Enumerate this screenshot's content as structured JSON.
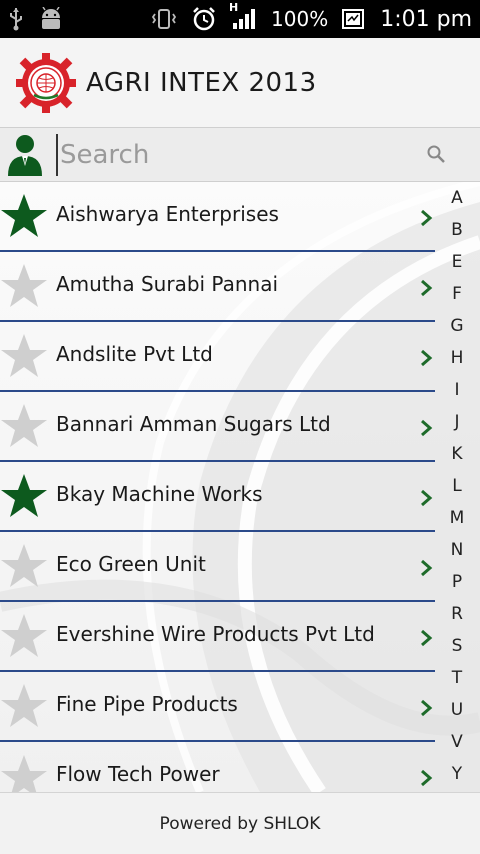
{
  "status_bar": {
    "battery": "100%",
    "time": "1:01 pm",
    "network_label": "H"
  },
  "header": {
    "title": "AGRI INTEX 2013"
  },
  "search": {
    "placeholder": "Search",
    "value": ""
  },
  "list": {
    "items": [
      {
        "label": "Aishwarya Enterprises",
        "favorite": true
      },
      {
        "label": "Amutha Surabi Pannai",
        "favorite": false
      },
      {
        "label": "Andslite Pvt Ltd",
        "favorite": false
      },
      {
        "label": "Bannari Amman Sugars Ltd",
        "favorite": false
      },
      {
        "label": "Bkay Machine Works",
        "favorite": true
      },
      {
        "label": "Eco Green Unit",
        "favorite": false
      },
      {
        "label": "Evershine Wire Products Pvt Ltd",
        "favorite": false
      },
      {
        "label": "Fine Pipe Products",
        "favorite": false
      },
      {
        "label": "Flow Tech Power",
        "favorite": false
      }
    ]
  },
  "alphabet_index": [
    "A",
    "B",
    "E",
    "F",
    "G",
    "H",
    "I",
    "J",
    "K",
    "L",
    "M",
    "N",
    "P",
    "R",
    "S",
    "T",
    "U",
    "V",
    "Y"
  ],
  "footer": {
    "text": "Powered by SHLOK"
  },
  "colors": {
    "favorite_star": "#0d5a1e",
    "empty_star": "#cfcfcf",
    "chevron": "#1e6b2a",
    "row_divider": "#2b4a8a",
    "logo_red": "#d8232a"
  },
  "icons": {
    "usb": "usb-icon",
    "android": "android-debug-icon",
    "vibrate": "vibrate-icon",
    "alarm": "alarm-clock-icon",
    "signal": "signal-icon",
    "battery": "battery-icon",
    "user": "user-icon",
    "search": "search-icon",
    "star": "star-icon",
    "chevron": "chevron-right-icon"
  }
}
